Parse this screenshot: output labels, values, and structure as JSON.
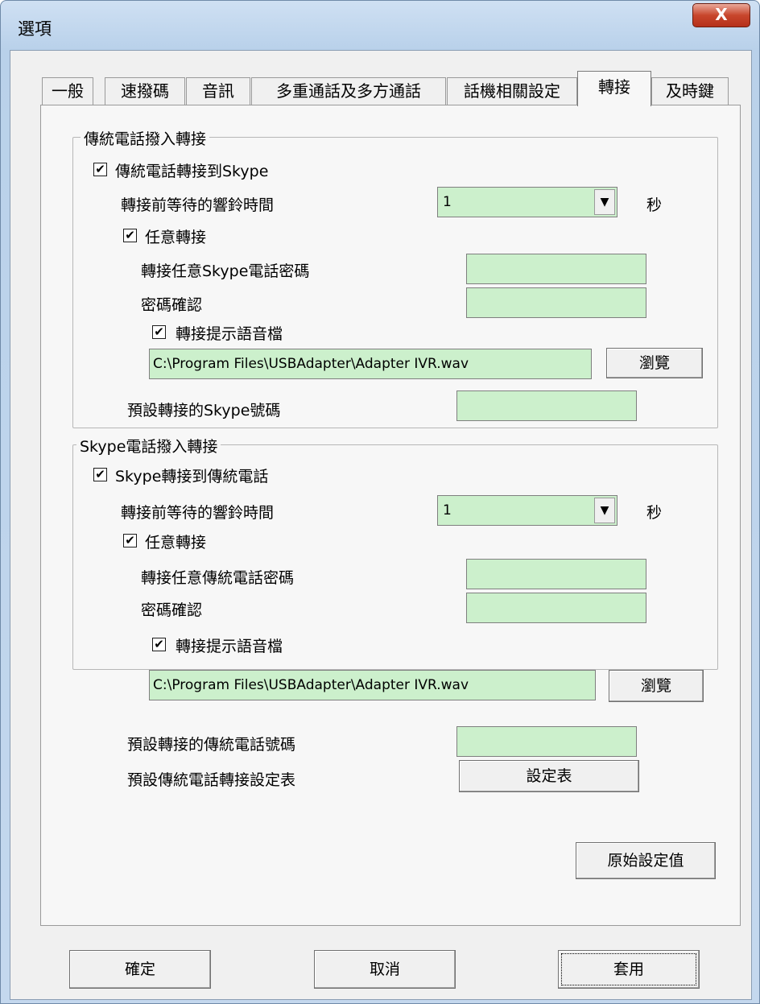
{
  "window": {
    "title": "選項",
    "close_glyph": "X"
  },
  "tabs": [
    {
      "label": "一般",
      "selected": false
    },
    {
      "label": "速撥碼",
      "selected": false
    },
    {
      "label": "音訊",
      "selected": false
    },
    {
      "label": "多重通話及多方通話",
      "selected": false
    },
    {
      "label": "話機相關設定",
      "selected": false
    },
    {
      "label": "轉接",
      "selected": true
    },
    {
      "label": "及時鍵",
      "selected": false
    }
  ],
  "pstn_group": {
    "legend": "傳統電話撥入轉接",
    "forward_to_skype": {
      "label": "傳統電話轉接到Skype",
      "checked": true
    },
    "wait_label": "轉接前等待的響鈴時間",
    "wait_value": "1",
    "wait_unit": "秒",
    "any_forward": {
      "label": "任意轉接",
      "checked": true
    },
    "password_label": "轉接任意Skype電話密碼",
    "password_value": "",
    "confirm_label": "密碼確認",
    "confirm_value": "",
    "prompt_file": {
      "label": "轉接提示語音檔",
      "checked": true
    },
    "file_path": "C:\\Program Files\\USBAdapter\\Adapter IVR.wav",
    "browse_label": "瀏覽",
    "default_number_label": "預設轉接的Skype號碼",
    "default_number_value": ""
  },
  "skype_group": {
    "legend": "Skype電話撥入轉接",
    "forward_to_pstn": {
      "label": "Skype轉接到傳統電話",
      "checked": true
    },
    "wait_label": "轉接前等待的響鈴時間",
    "wait_value": "1",
    "wait_unit": "秒",
    "any_forward": {
      "label": "任意轉接",
      "checked": true
    },
    "password_label": "轉接任意傳統電話密碼",
    "password_value": "",
    "confirm_label": "密碼確認",
    "confirm_value": "",
    "prompt_file": {
      "label": "轉接提示語音檔",
      "checked": true
    },
    "file_path": "C:\\Program Files\\USBAdapter\\Adapter IVR.wav",
    "browse_label": "瀏覽",
    "default_number_label": "預設轉接的傳統電話號碼",
    "default_number_value": "",
    "table_label": "預設傳統電話轉接設定表",
    "table_button": "設定表"
  },
  "defaults_button": "原始設定值",
  "footer": {
    "ok": "確定",
    "cancel": "取消",
    "apply": "套用"
  },
  "check_glyph": "✔",
  "dropdown_glyph": "▼"
}
